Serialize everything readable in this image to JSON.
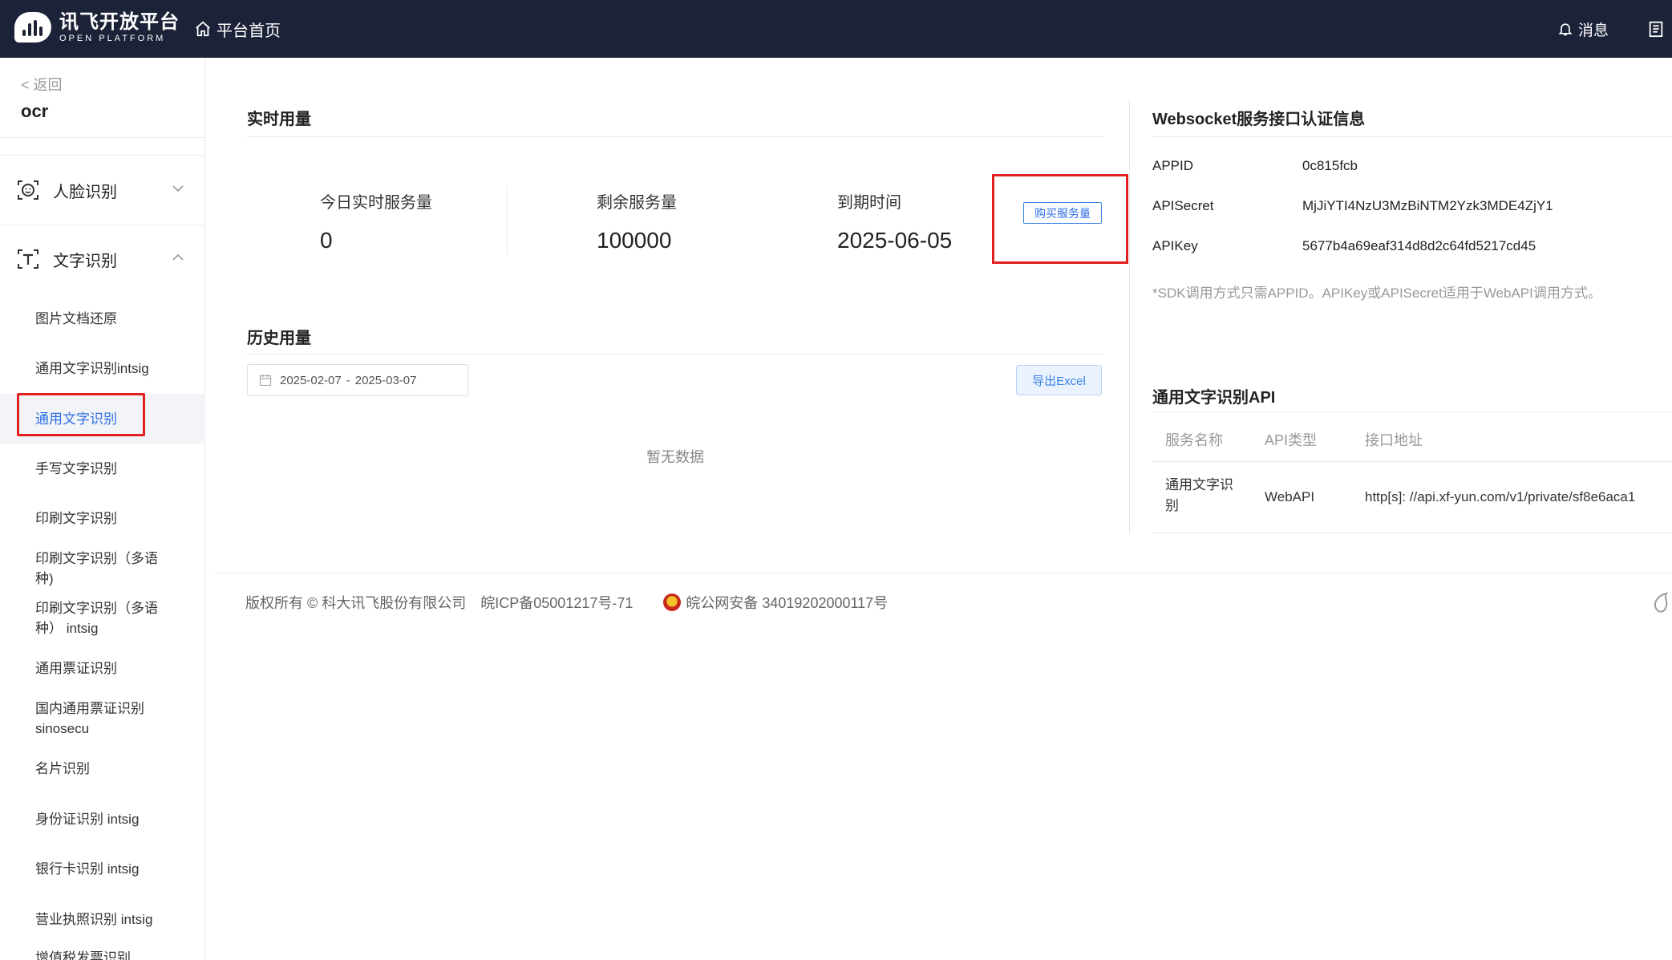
{
  "topbar": {
    "logo_cn": "讯飞开放平台",
    "logo_en": "OPEN PLATFORM",
    "home_label": "平台首页",
    "messages_label": "消息"
  },
  "sidebar": {
    "back_label": "< 返回",
    "app_name": "ocr",
    "groups": [
      {
        "label": "人脸识别",
        "icon": "face-scan-icon",
        "expanded": false
      },
      {
        "label": "文字识别",
        "icon": "text-scan-icon",
        "expanded": true
      }
    ],
    "items": [
      "图片文档还原",
      "通用文字识别intsig",
      "通用文字识别",
      "手写文字识别",
      "印刷文字识别",
      "印刷文字识别（多语种)",
      "印刷文字识别（多语种） intsig",
      "通用票证识别",
      "国内通用票证识别 sinosecu",
      "名片识别",
      "身份证识别 intsig",
      "银行卡识别 intsig",
      "营业执照识别 intsig",
      "增值税发票识别"
    ],
    "active_item": "通用文字识别",
    "accent_color": "#2f6fe6",
    "highlight_color": "#e21f1f"
  },
  "realtime": {
    "title": "实时用量",
    "stats": [
      {
        "label": "今日实时服务量",
        "value": "0"
      },
      {
        "label": "剩余服务量",
        "value": "100000"
      },
      {
        "label": "到期时间",
        "value": "2025-06-05"
      }
    ],
    "buy_button": "购买服务量"
  },
  "history": {
    "title": "历史用量",
    "date_start": "2025-02-07",
    "date_sep": "-",
    "date_end": "2025-03-07",
    "export_button": "导出Excel",
    "empty_text": "暂无数据"
  },
  "auth": {
    "title": "Websocket服务接口认证信息",
    "rows": [
      {
        "label": "APPID",
        "value": "0c815fcb"
      },
      {
        "label": "APISecret",
        "value": "MjJiYTI4NzU3MzBiNTM2Yzk3MDE4ZjY1"
      },
      {
        "label": "APIKey",
        "value": "5677b4a69eaf314d8d2c64fd5217cd45"
      }
    ],
    "note": "*SDK调用方式只需APPID。APIKey或APISecret适用于WebAPI调用方式。"
  },
  "api": {
    "title": "通用文字识别API",
    "headers": [
      "服务名称",
      "API类型",
      "接口地址"
    ],
    "row": {
      "name_line1": "通用文字识",
      "name_line2": "别",
      "type": "WebAPI",
      "url": "http[s]: //api.xf-yun.com/v1/private/sf8e6aca1"
    }
  },
  "footer": {
    "copyright": "版权所有 © 科大讯飞股份有限公司",
    "icp": "皖ICP备05001217号-71",
    "police": "皖公网安备 34019202000117号"
  }
}
